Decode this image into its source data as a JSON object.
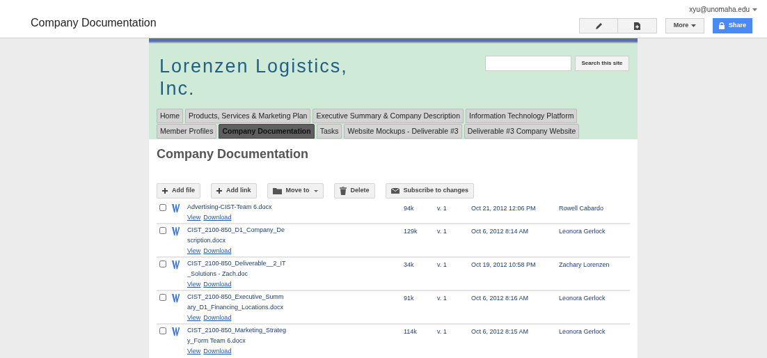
{
  "app_bar": {
    "title": "Company Documentation",
    "user": "xyu@unomaha.edu",
    "more_label": "More",
    "share_label": "Share"
  },
  "site": {
    "title": "Lorenzen Logistics, Inc.",
    "search_button": "Search this site"
  },
  "tabs": [
    {
      "label": "Home",
      "selected": false
    },
    {
      "label": "Products, Services & Marketing Plan",
      "selected": false
    },
    {
      "label": "Executive Summary & Company Description",
      "selected": false
    },
    {
      "label": "Information Technology Platform",
      "selected": false
    },
    {
      "label": "Member Profiles",
      "selected": false
    },
    {
      "label": "Company Documentation",
      "selected": true
    },
    {
      "label": "Tasks",
      "selected": false
    },
    {
      "label": "Website Mockups - Deliverable #3",
      "selected": false
    },
    {
      "label": "Deliverable #3 Company Website",
      "selected": false
    }
  ],
  "page_title": "Company Documentation",
  "toolbar": [
    {
      "kind": "add",
      "label": "Add file"
    },
    {
      "kind": "add",
      "label": "Add link"
    },
    {
      "kind": "folder",
      "label": "Move to"
    },
    {
      "kind": "trash",
      "label": "Delete"
    },
    {
      "kind": "mail",
      "label": "Subscribe to changes"
    }
  ],
  "files": [
    {
      "name": "Advertising-CIST-Team 6.docx",
      "size": "94k",
      "version": "v. 1",
      "date": "Oct 21, 2012 12:06 PM",
      "author": "Rowell Cabardo",
      "view": "View",
      "download": "Download",
      "checked": false
    },
    {
      "name": "CIST_2100-850_D1_Company_Description.docx",
      "size": "129k",
      "version": "v. 1",
      "date": "Oct 6, 2012 8:14 AM",
      "author": "Leonora Gerlock",
      "view": "View",
      "download": "Download",
      "checked": false
    },
    {
      "name": "CIST_2100-850_Deliverable__2_IT_Solutions - Zach.doc",
      "size": "34k",
      "version": "v. 1",
      "date": "Oct 19, 2012 10:58 PM",
      "author": "Zachary Lorenzen",
      "view": "View",
      "download": "Download",
      "checked": false
    },
    {
      "name": "CIST_2100-850_Executive_Summary_D1_Financing_Locations.docx",
      "size": "91k",
      "version": "v. 1",
      "date": "Oct 6, 2012 8:16 AM",
      "author": "Leonora Gerlock",
      "view": "View",
      "download": "Download",
      "checked": false
    },
    {
      "name": "CIST_2100-850_Marketing_Strategy_Form Team 6.docx",
      "size": "114k",
      "version": "v. 1",
      "date": "Oct 6, 2012 8:15 AM",
      "author": "Leonora Gerlock",
      "view": "View",
      "download": "Download",
      "checked": false
    }
  ]
}
